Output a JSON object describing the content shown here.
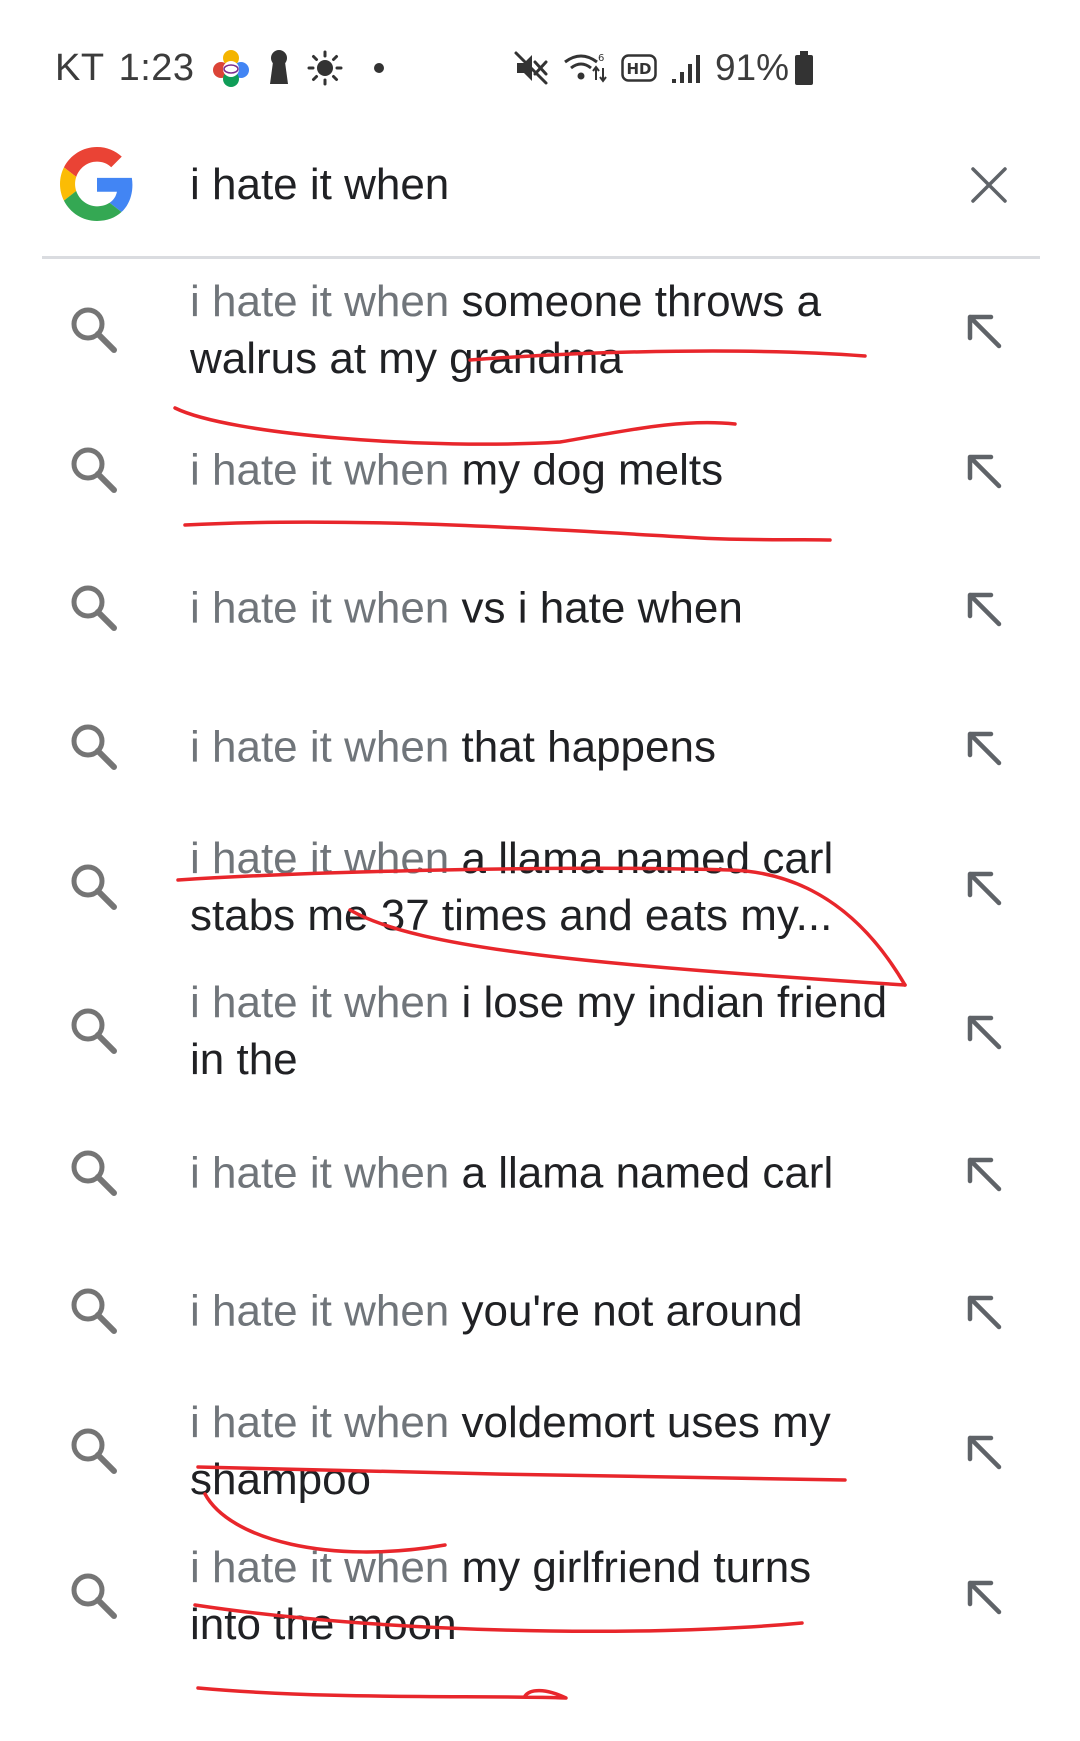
{
  "status_bar": {
    "carrier": "KT",
    "time": "1:23",
    "battery_percent": "91%",
    "left_icons": [
      "colorful-app-icon",
      "keyhole-icon",
      "brightness-icon",
      "dot-icon"
    ],
    "right_icons": [
      "mute-icon",
      "wifi-6-icon",
      "hd-icon",
      "signal-icon",
      "battery-icon"
    ],
    "battery_level": 0.91
  },
  "search": {
    "query": "i hate it when",
    "logo": "google-g-logo",
    "clear_icon": "close-icon"
  },
  "suggestions": [
    {
      "prefix": "i hate it when",
      "rest": "someone throws a walrus at my grandma"
    },
    {
      "prefix": "i hate it when",
      "rest": "my dog melts"
    },
    {
      "prefix": "i hate it when",
      "rest": "vs i hate when"
    },
    {
      "prefix": "i hate it when",
      "rest": "that happens"
    },
    {
      "prefix": "i hate it when",
      "rest": "a llama named carl stabs me 37 times and eats my..."
    },
    {
      "prefix": "i hate it when",
      "rest": "i lose my indian friend in the"
    },
    {
      "prefix": "i hate it when",
      "rest": "a llama named carl"
    },
    {
      "prefix": "i hate it when",
      "rest": "you're not around"
    },
    {
      "prefix": "i hate it when",
      "rest": "voldemort uses my shampoo"
    },
    {
      "prefix": "i hate it when",
      "rest": "my girlfriend turns into the moon"
    }
  ],
  "colors": {
    "suggestion_prefix": "#70757a",
    "suggestion_text": "#202124",
    "icon_gray": "#757575",
    "scribble_red": "#e8262b",
    "google_blue": "#4285F4",
    "google_red": "#EA4335",
    "google_yellow": "#FBBC05",
    "google_green": "#34A853"
  }
}
